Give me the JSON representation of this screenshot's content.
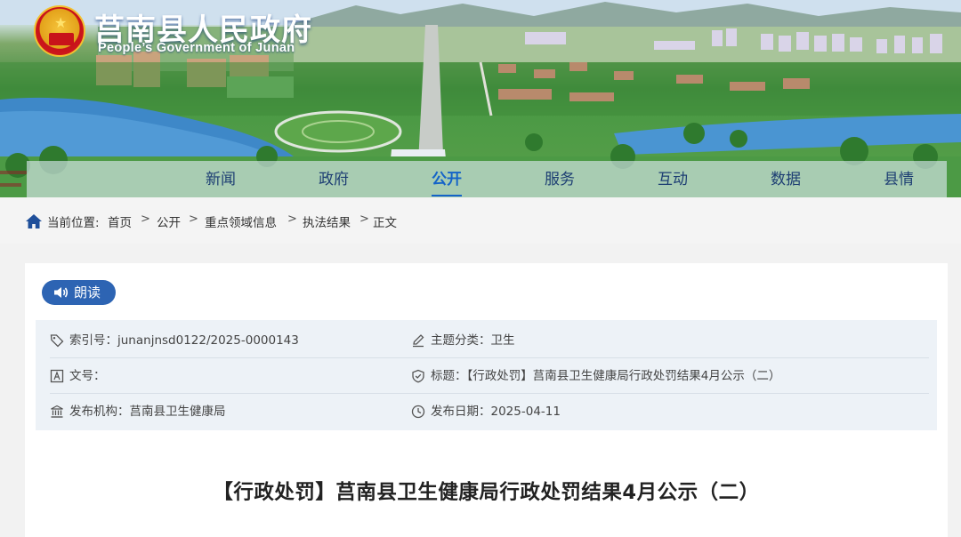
{
  "header": {
    "site_title": "莒南县人民政府",
    "site_subtitle": "People’s Government of Junan",
    "emblem_icon": "national-emblem-icon",
    "colors": {
      "nav_text": "#1d3e73",
      "nav_active": "#1463c8",
      "brand_blue": "#2d64b3"
    }
  },
  "nav": {
    "items": [
      {
        "label": "新闻"
      },
      {
        "label": "政府"
      },
      {
        "label": "公开",
        "active": true
      },
      {
        "label": "服务"
      },
      {
        "label": "互动"
      },
      {
        "label": "数据"
      },
      {
        "label": "县情"
      }
    ]
  },
  "breadcrumb": {
    "icon": "home-icon",
    "prefix": "当前位置:",
    "items": [
      "首页",
      "公开",
      "重点领域信息",
      "执法结果",
      "正文"
    ],
    "separator": ">"
  },
  "reader": {
    "label": "朗读",
    "icon": "speaker-icon"
  },
  "meta": {
    "index_no": "索引号：junanjnsd0122/2025-0000143",
    "topic": "主题分类：卫生",
    "doc_no": "文号：",
    "title": "标题：【行政处罚】莒南县卫生健康局行政处罚结果4月公示（二）",
    "publisher": "发布机构：莒南县卫生健康局",
    "publish_date": "发布日期：2025-04-11"
  },
  "article": {
    "title": "【行政处罚】莒南县卫生健康局行政处罚结果4月公示（二）"
  }
}
